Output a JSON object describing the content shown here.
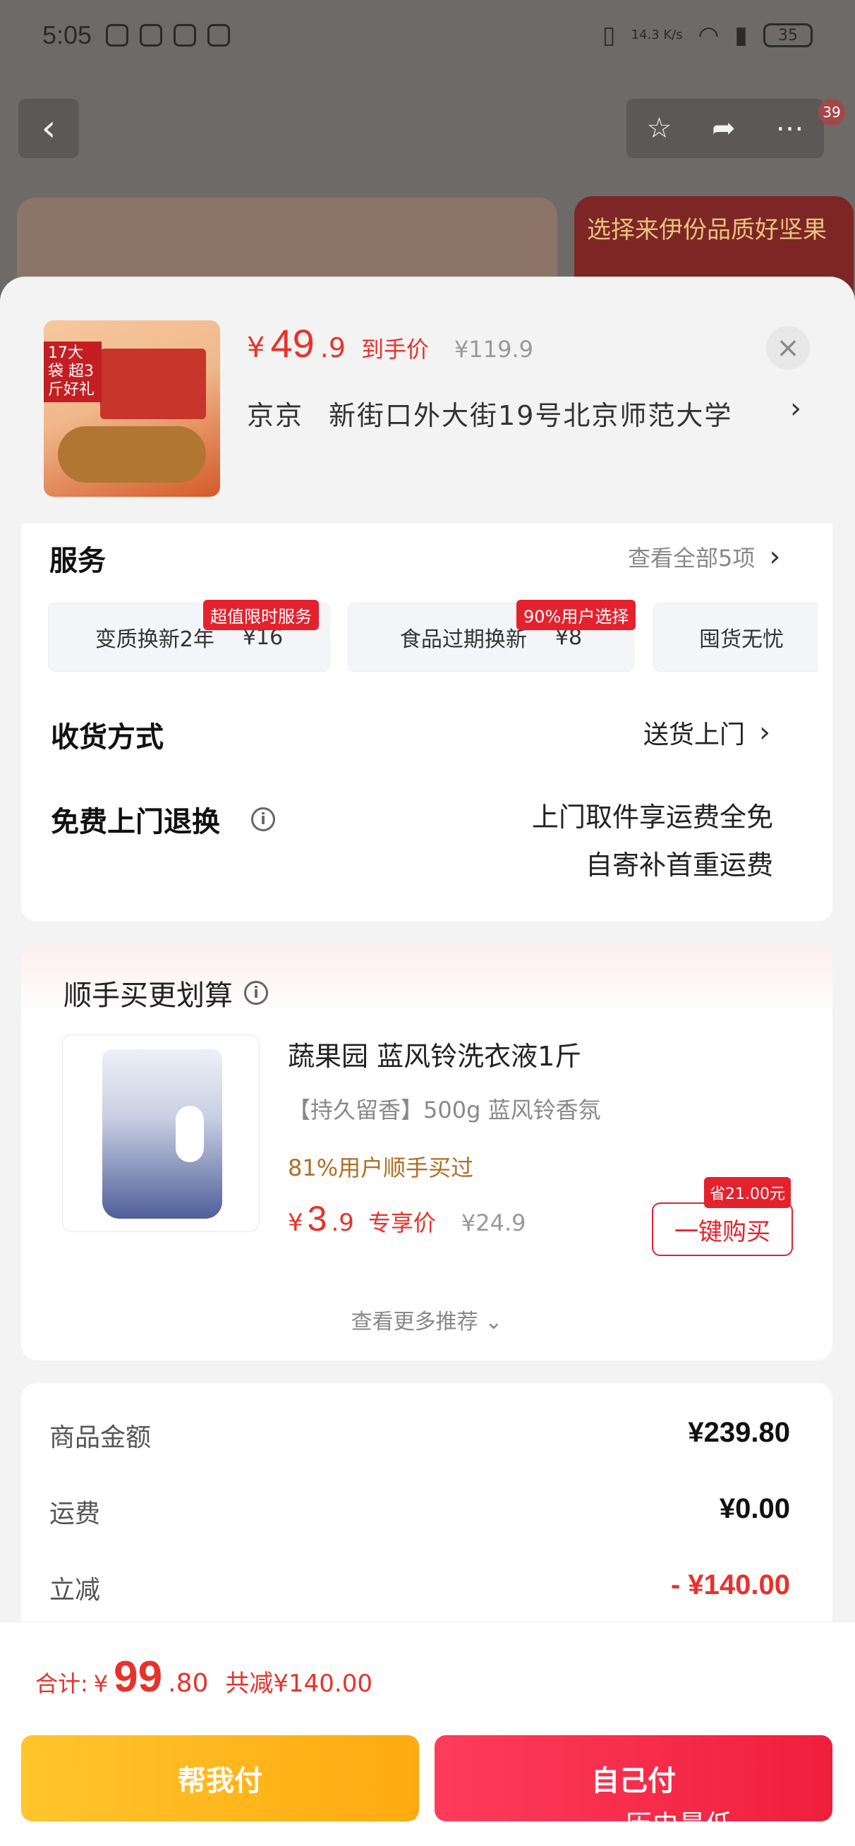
{
  "status_bar": {
    "time": "5:05",
    "speed": "14.3\nK/s",
    "battery": "35"
  },
  "background": {
    "badge_count": "39",
    "banner_text": "选择来伊份品质好坚果"
  },
  "product": {
    "thumb_tag": "17大袋 超3斤好礼",
    "price_currency": "¥",
    "price_int": "49",
    "price_dec": ".9",
    "price_label": "到手价",
    "original_price": "¥119.9",
    "address_city": "京京",
    "address_detail": "新街口外大街19号北京师范大学"
  },
  "services": {
    "title": "服务",
    "view_all": "查看全部5项",
    "chips": [
      {
        "label": "变质换新2年",
        "price": "¥16",
        "badge": "超值限时服务"
      },
      {
        "label": "食品过期换新",
        "price": "¥8",
        "badge": "90%用户选择"
      },
      {
        "label": "囤货无忧",
        "price": "",
        "badge": ""
      }
    ]
  },
  "delivery": {
    "title": "收货方式",
    "value": "送货上门"
  },
  "free_return": {
    "title": "免费上门退换",
    "line1": "上门取件享运费全免",
    "line2": "自寄补首重运费"
  },
  "recommend": {
    "title": "顺手买更划算",
    "name": "蔬果园  蓝风铃洗衣液1斤",
    "sub": "【持久留香】500g  蓝风铃香氛",
    "bought": "81%用户顺手买过",
    "price_currency": "¥",
    "price_int": "3",
    "price_dec": ".9",
    "price_label": "专享价",
    "original_price": "¥24.9",
    "save_badge": "省21.00元",
    "buy_label": "一键购买",
    "more_label": "查看更多推荐 ⌄"
  },
  "summary": [
    {
      "label": "商品金额",
      "value": "¥239.80"
    },
    {
      "label": "运费",
      "value": "¥0.00"
    },
    {
      "label": "立减",
      "value": "- ¥140.00"
    }
  ],
  "footer": {
    "total_label": "合计:",
    "total_currency": "¥",
    "total_int": "99",
    "total_dec": ".80",
    "saved": "共减¥140.00",
    "pay_friend": "帮我付",
    "pay_self": "自己付",
    "watermark": "历史最低"
  },
  "colors": {
    "accent_red": "#e7322b",
    "pay_friend": "#ffb81c",
    "pay_self": "#f5304d"
  }
}
